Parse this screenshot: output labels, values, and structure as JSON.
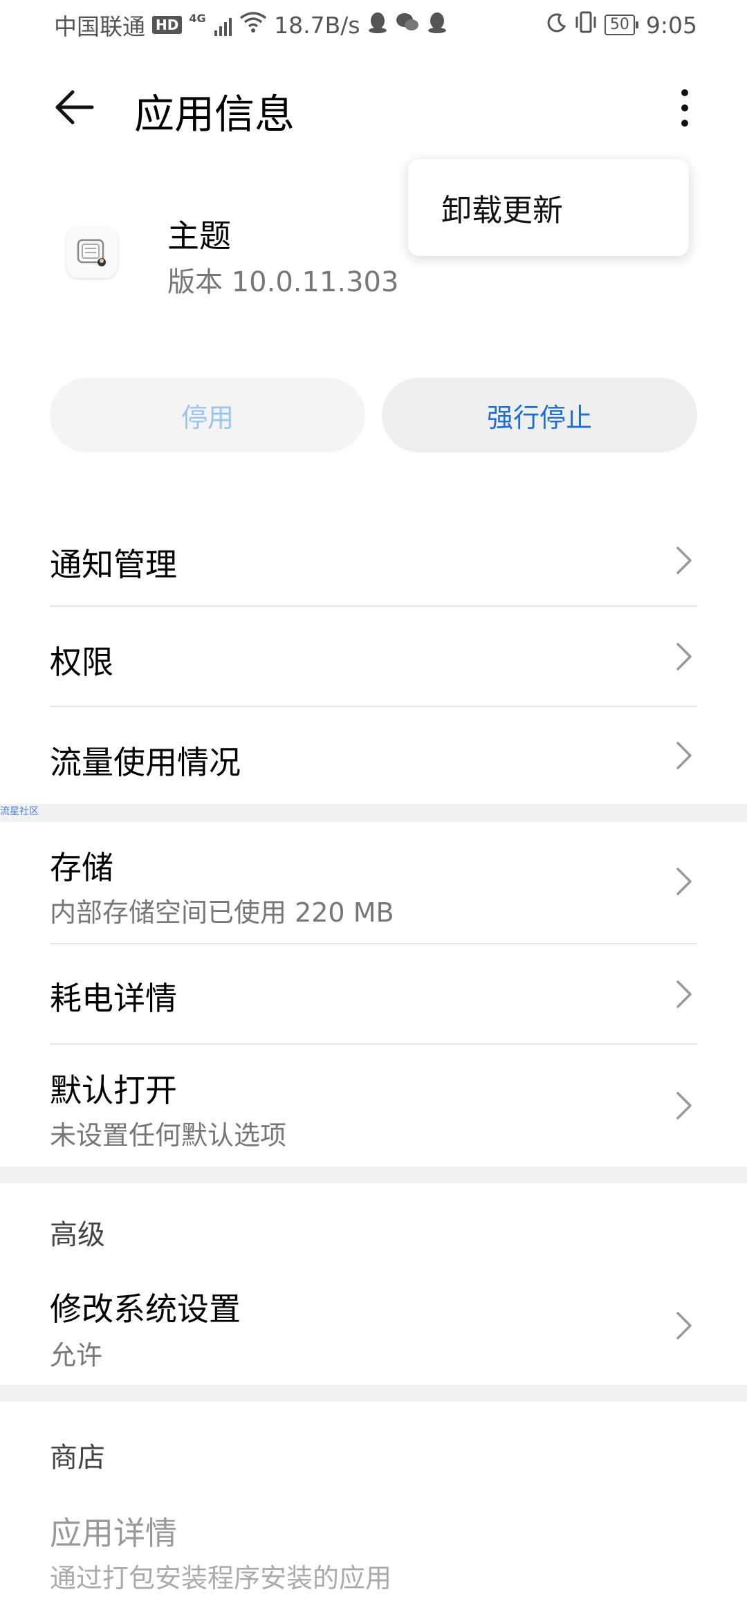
{
  "status_bar": {
    "carrier": "中国联通",
    "hd": "HD",
    "network": "4G",
    "speed": "18.7B/s",
    "battery": "50",
    "time": "9:05",
    "icons": [
      "hd-icon",
      "signal-icon",
      "wifi-icon",
      "qq-icon",
      "wechat-icon",
      "qq-icon",
      "moon-icon",
      "vibrate-icon",
      "battery-icon"
    ]
  },
  "appbar": {
    "title": "应用信息"
  },
  "popup": {
    "item": "卸载更新"
  },
  "app": {
    "name": "主题",
    "version": "版本 10.0.11.303"
  },
  "buttons": {
    "disable": "停用",
    "force_stop": "强行停止"
  },
  "colors": {
    "accent": "#1a6fd1",
    "disabled_button_text": "#9ac6ec",
    "section_gap": "#f1f1f1"
  },
  "list1": [
    {
      "title": "通知管理"
    },
    {
      "title": "权限"
    },
    {
      "title": "流量使用情况"
    }
  ],
  "watermark": "流星社区",
  "list2": {
    "storage": {
      "title": "存储",
      "sub": "内部存储空间已使用 220 MB"
    },
    "battery": {
      "title": "耗电详情"
    },
    "default_open": {
      "title": "默认打开",
      "sub": "未设置任何默认选项"
    }
  },
  "advanced": {
    "label": "高级",
    "modify_settings": {
      "title": "修改系统设置",
      "sub": "允许"
    }
  },
  "store": {
    "label": "商店",
    "app_details": {
      "title": "应用详情",
      "sub": "通过打包安装程序安装的应用"
    }
  }
}
